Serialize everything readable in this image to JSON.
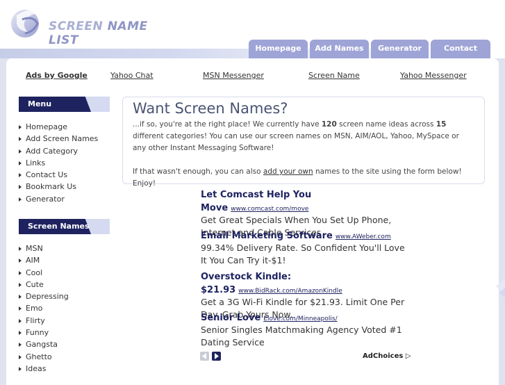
{
  "header": {
    "logo_part1": "SCREEN ",
    "logo_part2": "NAME LIST",
    "nav": [
      "Homepage",
      "Add Names",
      "Generator",
      "Contact"
    ]
  },
  "adlinks": {
    "label": "Ads by Google",
    "items": [
      "Yahoo Chat",
      "MSN Messenger",
      "Screen Name",
      "Yahoo Messenger"
    ]
  },
  "sidebar": {
    "menu_title": "Menu",
    "menu_items": [
      "Homepage",
      "Add Screen Names",
      "Add Category",
      "Links",
      "Contact Us",
      "Bookmark Us",
      "Generator"
    ],
    "names_title": "Screen Names",
    "names_items": [
      "MSN",
      "AIM",
      "Cool",
      "Cute",
      "Depressing",
      "Emo",
      "Flirty",
      "Funny",
      "Gangsta",
      "Ghetto",
      "Ideas"
    ]
  },
  "intro": {
    "title": "Want Screen Names?",
    "p1_a": "...if so, you're at the right place! We currently have ",
    "count_ideas": "120",
    "p1_b": " screen name ideas across ",
    "count_categories": "15",
    "p1_c": " different categories! You can use our screen names on MSN, AIM/AOL, Yahoo, MySpace or any other Instant Messaging Software!",
    "p2_a": "If that wasn't enough, you can also ",
    "p2_link": "add your own",
    "p2_b": " names to the site using the form below! Enjoy!"
  },
  "ads": [
    {
      "title": "Let Comcast Help You Move",
      "url": "www.comcast.com/move",
      "desc": "Get Great Specials When You Set Up Phone, Internet and Cable Services"
    },
    {
      "title": "Email Marketing Software",
      "url": "www.AWeber.com",
      "desc": "99.34% Delivery Rate. So Confident You'll Love It You Can Try it-$1!"
    },
    {
      "title": "Overstock Kindle: $21.93",
      "url": "www.BidRack.com/AmazonKindle",
      "desc": "Get a 3G Wi-Fi Kindle for $21.93. Limit One Per Day. Grab Yours Now."
    },
    {
      "title": "Senior Love",
      "url": "Elove.com/Minneapolis/",
      "desc": "Senior Singles Matchmaking Agency Voted #1 Dating Service"
    }
  ],
  "adchoices": "AdChoices",
  "colors": {
    "nav_tab": "#9ea4d6",
    "sidebar_head": "#1e2360",
    "accent": "#1e2360"
  }
}
